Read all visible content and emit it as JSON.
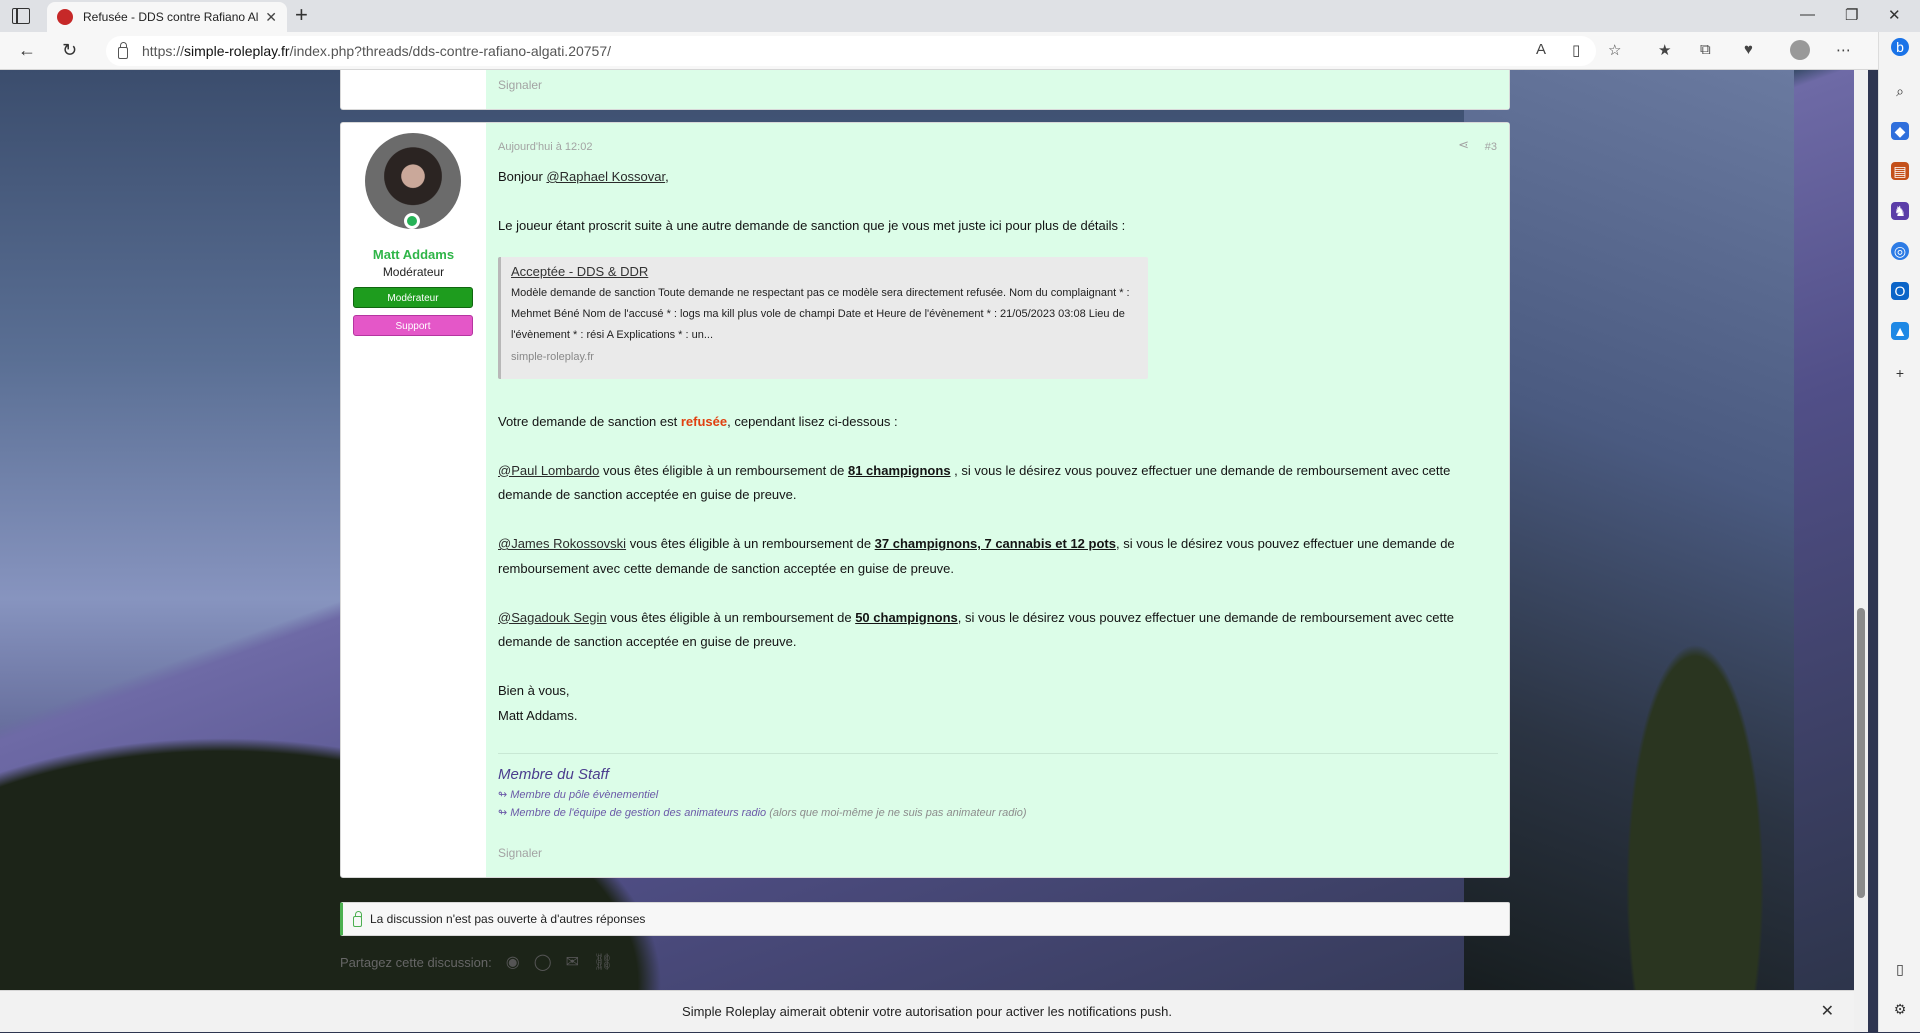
{
  "browser": {
    "tab_title": "Refusée - DDS contre Rafiano Al...",
    "url_prefix": "https://",
    "url_host": "simple-roleplay.fr",
    "url_path": "/index.php?threads/dds-contre-rafiano-algati.20757/"
  },
  "previous_post": {
    "report_label": "Signaler"
  },
  "post": {
    "username": "Matt Addams",
    "user_title": "Modérateur",
    "banners": [
      "Modérateur",
      "Support"
    ],
    "date": "Aujourd'hui à 12:02",
    "number": "#3",
    "greeting_prefix": "Bonjour ",
    "greeting_mention": "@Raphael Kossovar",
    "greeting_suffix": ",",
    "intro": "Le joueur étant proscrit suite à une autre demande de sanction que je vous met juste ici pour plus de détails :",
    "unfurl": {
      "title": "Acceptée - DDS & DDR",
      "description": "Modèle demande de sanction Toute demande ne respectant pas ce modèle sera directement refusée. Nom du complaignant * : Mehmet Béné Nom de l'accusé * : logs ma kill plus vole de champi Date et Heure de l'évènement * : 21/05/2023 03:08 Lieu de l'évènement * : rési A Explications * : un...",
      "site": "simple-roleplay.fr"
    },
    "verdict_prefix": "Votre demande de sanction est ",
    "verdict_word": "refusée",
    "verdict_suffix": ", cependant lisez ci-dessous :",
    "refunds": [
      {
        "mention": "@Paul Lombardo",
        "mid": " vous êtes éligible à un remboursement de ",
        "amount": "81 champignons",
        "rest": " , si vous le désirez vous pouvez effectuer une demande de remboursement avec cette demande de sanction acceptée en guise de preuve."
      },
      {
        "mention": "@James Rokossovski",
        "mid": " vous êtes éligible à un remboursement de ",
        "amount": "37 champignons, 7 cannabis et 12 pots",
        "rest": ", si vous le désirez vous pouvez effectuer une demande de remboursement avec cette demande de sanction acceptée en guise de preuve."
      },
      {
        "mention": "@Sagadouk Segin",
        "mid": " vous êtes éligible à un remboursement de ",
        "amount": "50 champignons",
        "rest": ", si vous le désirez vous pouvez effectuer une demande de remboursement avec cette demande de sanction acceptée en guise de preuve."
      }
    ],
    "closing_1": "Bien à vous,",
    "closing_2": "Matt Addams.",
    "signature": {
      "title": "Membre du Staff",
      "line1": "↬ Membre du pôle évènementiel",
      "line2": "↬ Membre de l'équipe de gestion des animateurs radio",
      "line2_note": " (alors que moi-même je ne suis pas animateur radio)"
    },
    "report_label": "Signaler"
  },
  "thread_locked": "La discussion n'est pas ouverte à d'autres réponses",
  "share_label": "Partagez cette discussion:",
  "notification": "Simple Roleplay aimerait obtenir votre autorisation pour activer les notifications push.",
  "colors": {
    "message_bg": "#dcfde8",
    "username": "#2fb548",
    "banner_mod": "#1e9c1e",
    "banner_support": "#e457c8",
    "refused": "#e04010",
    "signature": "#4b3d8e"
  }
}
